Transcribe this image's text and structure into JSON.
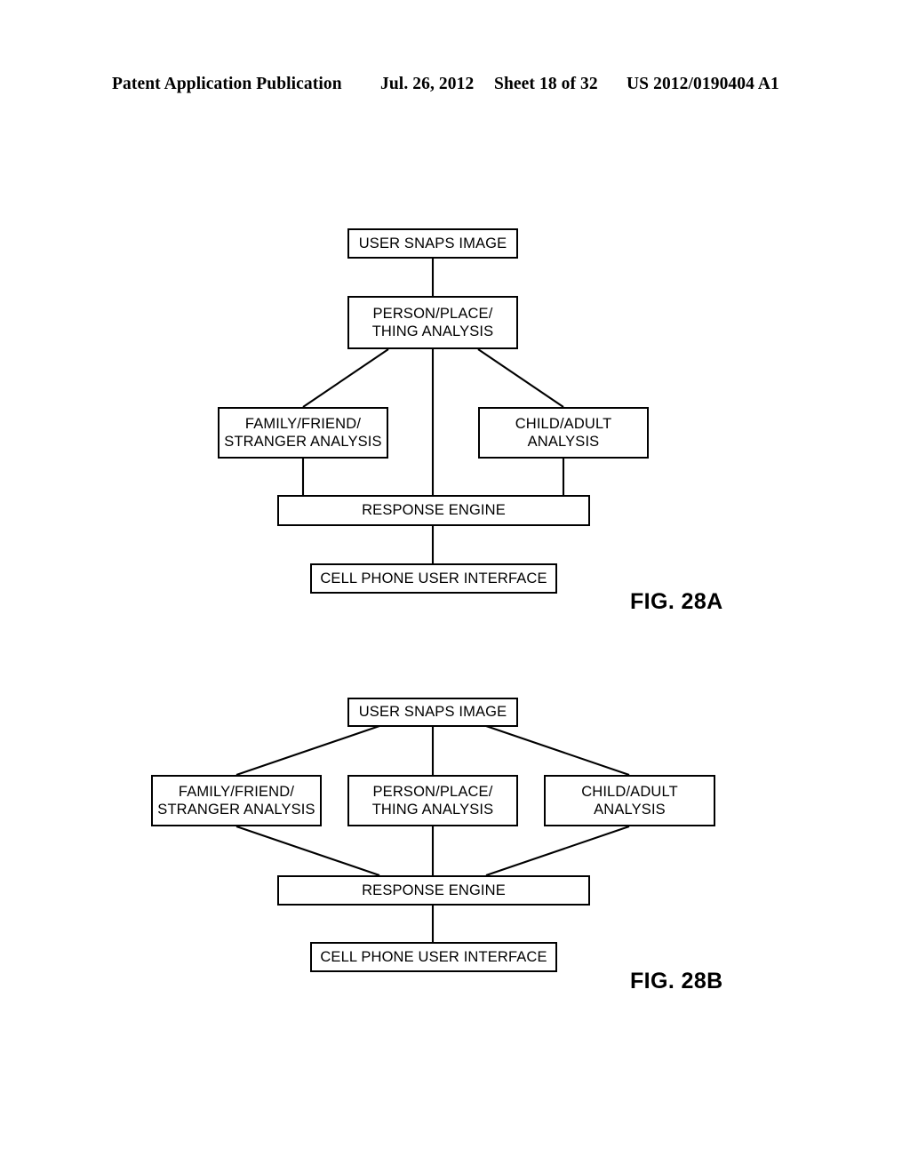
{
  "header": {
    "publication": "Patent Application Publication",
    "date": "Jul. 26, 2012",
    "sheet": "Sheet 18 of 32",
    "patent_number": "US 2012/0190404 A1"
  },
  "figures": [
    {
      "caption": "FIG. 28A",
      "nodes": {
        "user_snaps_image": "USER SNAPS IMAGE",
        "person_place_thing": "PERSON/PLACE/\nTHING ANALYSIS",
        "family_friend_stranger": "FAMILY/FRIEND/\nSTRANGER ANALYSIS",
        "child_adult": "CHILD/ADULT\nANALYSIS",
        "response_engine": "RESPONSE ENGINE",
        "cell_phone_ui": "CELL PHONE USER INTERFACE"
      }
    },
    {
      "caption": "FIG. 28B",
      "nodes": {
        "user_snaps_image": "USER SNAPS IMAGE",
        "family_friend_stranger": "FAMILY/FRIEND/\nSTRANGER ANALYSIS",
        "person_place_thing": "PERSON/PLACE/\nTHING ANALYSIS",
        "child_adult": "CHILD/ADULT\nANALYSIS",
        "response_engine": "RESPONSE ENGINE",
        "cell_phone_ui": "CELL PHONE USER INTERFACE"
      }
    }
  ],
  "colors": {
    "ink": "#000000",
    "paper": "#ffffff"
  }
}
